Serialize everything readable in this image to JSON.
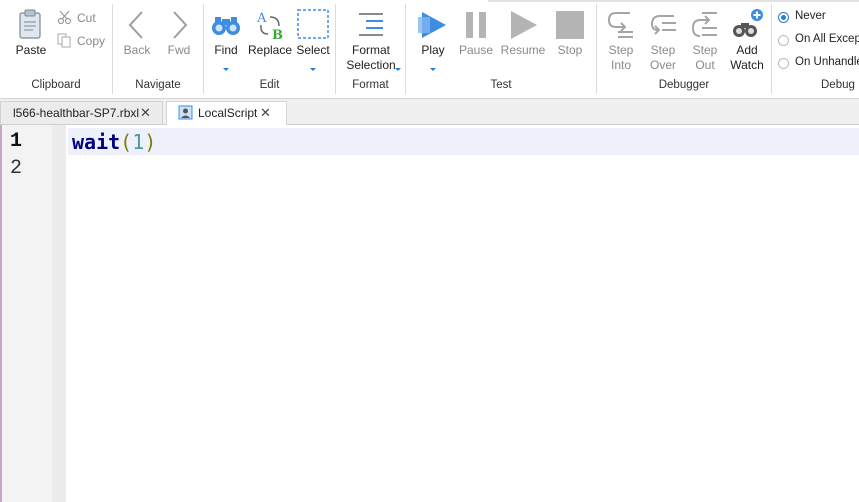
{
  "ribbon": {
    "clipboard": {
      "group_label": "Clipboard",
      "paste": "Paste",
      "cut": "Cut",
      "copy": "Copy"
    },
    "navigate": {
      "group_label": "Navigate",
      "back": "Back",
      "fwd": "Fwd"
    },
    "edit": {
      "group_label": "Edit",
      "find": "Find",
      "replace": "Replace",
      "select": "Select"
    },
    "format": {
      "group_label": "Format",
      "format_line1": "Format",
      "format_line2": "Selection"
    },
    "test": {
      "group_label": "Test",
      "play": "Play",
      "pause": "Pause",
      "resume": "Resume",
      "stop": "Stop"
    },
    "debugger": {
      "group_label": "Debugger",
      "step_into_1": "Step",
      "step_into_2": "Into",
      "step_over_1": "Step",
      "step_over_2": "Over",
      "step_out_1": "Step",
      "step_out_2": "Out",
      "add_watch_1": "Add",
      "add_watch_2": "Watch"
    },
    "debug_errors": {
      "group_label": "Debug E",
      "options": [
        "Never",
        "On All Except",
        "On Unhandle"
      ],
      "selected": "Never"
    }
  },
  "tabs": [
    {
      "label": "l566-healthbar-SP7.rbxl",
      "active": false
    },
    {
      "label": "LocalScript",
      "active": true
    }
  ],
  "editor": {
    "line_numbers": [
      "1",
      "2"
    ],
    "code": {
      "keyword": "wait",
      "open": "(",
      "number": "1",
      "close": ")"
    }
  }
}
